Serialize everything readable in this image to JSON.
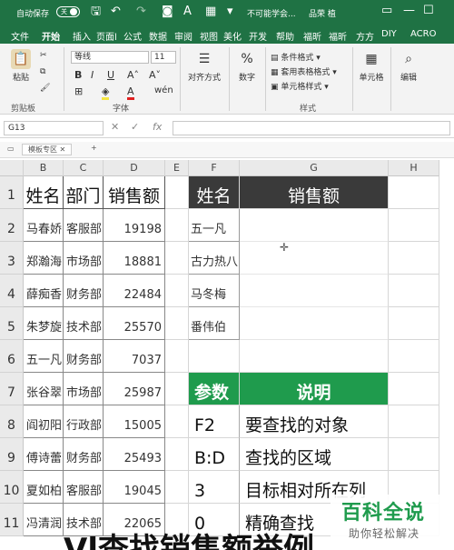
{
  "titlebar": {
    "autosave_label": "自动保存",
    "autosave_state": "关",
    "doc_title": "不可能学会...",
    "user": "品荣 植"
  },
  "ribbon_tabs": [
    "文件",
    "开始",
    "插入",
    "页面l",
    "公式",
    "数据",
    "审阅",
    "视图",
    "美化",
    "开发",
    "帮助",
    "福昕",
    "福昕",
    "方方",
    "DIY",
    "ACRO"
  ],
  "ribbon": {
    "paste": "粘贴",
    "clipboard": "剪贴板",
    "font_name": "等线",
    "font_size": "11",
    "bold": "B",
    "italic": "I",
    "underline": "U",
    "font_group": "字体",
    "align": "对齐方式",
    "number": "数字",
    "cond_format": "条件格式",
    "table_format": "套用表格格式",
    "cell_style": "单元格样式",
    "style_group": "样式",
    "cells": "单元格",
    "editing": "编辑"
  },
  "formula_bar": {
    "name_box": "G13",
    "fx": "fx"
  },
  "sheet_tab": "模板专区",
  "columns": [
    "B",
    "C",
    "D",
    "E",
    "F",
    "G",
    "H"
  ],
  "rows": [
    "1",
    "2",
    "3",
    "4",
    "5",
    "6",
    "7",
    "8",
    "9",
    "10",
    "11"
  ],
  "table_left": {
    "headers": [
      "姓名",
      "部门",
      "销售额"
    ],
    "rows": [
      [
        "马春娇",
        "客服部",
        "19198"
      ],
      [
        "郑瀚海",
        "市场部",
        "18881"
      ],
      [
        "薛痴香",
        "财务部",
        "22484"
      ],
      [
        "朱梦旋",
        "技术部",
        "25570"
      ],
      [
        "五一凡",
        "财务部",
        "7037"
      ],
      [
        "张谷翠",
        "市场部",
        "25987"
      ],
      [
        "阎初阳",
        "行政部",
        "15005"
      ],
      [
        "傅诗蕾",
        "财务部",
        "25493"
      ],
      [
        "夏如柏",
        "客服部",
        "19045"
      ],
      [
        "冯清润",
        "技术部",
        "22065"
      ]
    ]
  },
  "table_lookup": {
    "headers": [
      "姓名",
      "销售额"
    ],
    "names": [
      "五一凡",
      "古力热八",
      "马冬梅",
      "番伟伯"
    ]
  },
  "table_params": {
    "headers": [
      "参数",
      "说明"
    ],
    "rows": [
      [
        "F2",
        "要查找的对象"
      ],
      [
        "B:D",
        "查找的区域"
      ],
      [
        "3",
        "目标相对所在列"
      ],
      [
        "0",
        "精确查找"
      ]
    ]
  },
  "watermark": {
    "brand": "百科全说",
    "sub": "助你轻松解决"
  },
  "caption": "Vl查找销售额举例",
  "colors": {
    "excel_green": "#1f7244",
    "header_dark": "#3a3a3a",
    "param_green": "#1f9b4d"
  }
}
